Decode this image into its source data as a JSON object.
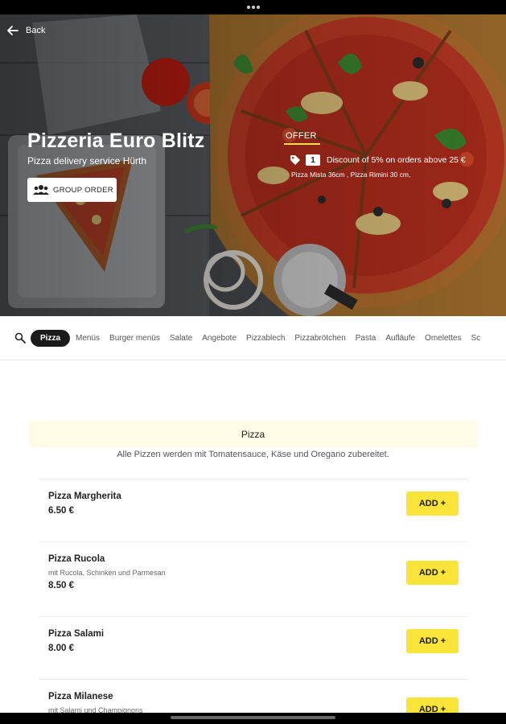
{
  "hero": {
    "back_label": "Back",
    "title": "Pizzeria Euro Blitz",
    "subtitle": "Pizza delivery service Hürth",
    "group_order_label": "GROUP ORDER",
    "offer": {
      "tab_label": "OFFER",
      "count": "1",
      "text": "Discount of 5% on orders above 25 €",
      "items": "Pizza Mista 36cm , Pizza Rimini 30 cm,"
    }
  },
  "categories": [
    {
      "label": "Pizza",
      "active": true
    },
    {
      "label": "Menüs"
    },
    {
      "label": "Burger menüs"
    },
    {
      "label": "Salate"
    },
    {
      "label": "Angebote"
    },
    {
      "label": "Pizzablech"
    },
    {
      "label": "Pizzabrötchen"
    },
    {
      "label": "Pasta"
    },
    {
      "label": "Aufläufe"
    },
    {
      "label": "Omelettes"
    },
    {
      "label": "Sc"
    }
  ],
  "section": {
    "title": "Pizza",
    "description": "Alle Pizzen werden mit Tomatensauce, Käse und Oregano zubereitet."
  },
  "items": [
    {
      "name": "Pizza Margherita",
      "description": "",
      "price": "6.50 €",
      "add_label": "ADD +"
    },
    {
      "name": "Pizza Rucola",
      "description": "mit Rucola, Schinken und Parmesan",
      "price": "8.50 €",
      "add_label": "ADD +"
    },
    {
      "name": "Pizza Salami",
      "description": "",
      "price": "8.00 €",
      "add_label": "ADD +"
    },
    {
      "name": "Pizza Milanese",
      "description": "mit Salami und Champignons",
      "price": "",
      "add_label": "ADD +"
    }
  ],
  "colors": {
    "accent": "#fbe43a",
    "section_bg": "#fffbe6",
    "active_tab_bg": "#1b1b1b"
  }
}
